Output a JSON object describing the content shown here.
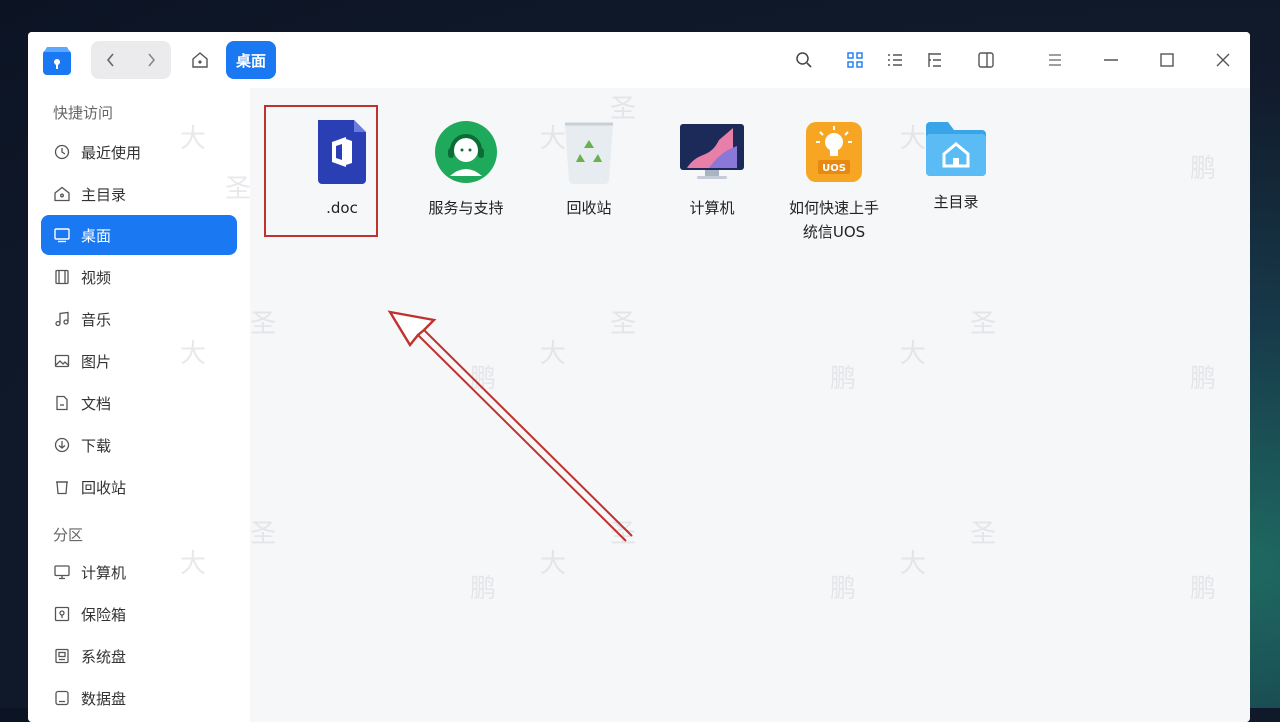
{
  "titlebar": {
    "back_icon": "chevron-left",
    "forward_icon": "chevron-right",
    "home_icon": "home",
    "breadcrumb": "桌面",
    "toolbar_icons": [
      "search",
      "icon-view",
      "list-view",
      "tree-view",
      "detail-panel",
      "menu",
      "minimize",
      "maximize",
      "close"
    ]
  },
  "sidebar": {
    "quick_access_title": "快捷访问",
    "quick_access": [
      {
        "label": "最近使用",
        "icon": "clock"
      },
      {
        "label": "主目录",
        "icon": "home"
      },
      {
        "label": "桌面",
        "icon": "desktop",
        "active": true
      },
      {
        "label": "视频",
        "icon": "video"
      },
      {
        "label": "音乐",
        "icon": "music"
      },
      {
        "label": "图片",
        "icon": "image"
      },
      {
        "label": "文档",
        "icon": "document"
      },
      {
        "label": "下载",
        "icon": "download"
      },
      {
        "label": "回收站",
        "icon": "trash"
      }
    ],
    "partitions_title": "分区",
    "partitions": [
      {
        "label": "计算机",
        "icon": "computer"
      },
      {
        "label": "保险箱",
        "icon": "safe"
      },
      {
        "label": "系统盘",
        "icon": "disk"
      },
      {
        "label": "数据盘",
        "icon": "disk"
      }
    ]
  },
  "desktop_items": [
    {
      "label": ".doc",
      "icon": "office-doc-icon"
    },
    {
      "label": "服务与支持",
      "icon": "support-icon"
    },
    {
      "label": "回收站",
      "icon": "trash-icon"
    },
    {
      "label": "计算机",
      "icon": "computer-icon"
    },
    {
      "label": "如何快速上手统信UOS",
      "icon": "uos-guide-icon"
    },
    {
      "label": "主目录",
      "icon": "home-folder-icon"
    }
  ],
  "annotation": {
    "highlight_color": "#c0322e",
    "arrow_color": "#c0322e"
  },
  "colors": {
    "accent": "#1a78f2"
  }
}
